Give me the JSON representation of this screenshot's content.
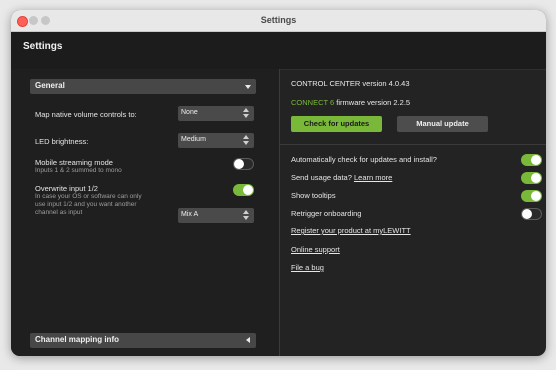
{
  "window": {
    "title": "Settings"
  },
  "app": {
    "title": "Settings"
  },
  "left": {
    "general_header": "General",
    "map_volume_label": "Map native volume controls to:",
    "map_volume_value": "None",
    "led_label": "LED brightness:",
    "led_value": "Medium",
    "mobile_label": "Mobile streaming mode",
    "mobile_sub": "Inputs 1 & 2 summed to mono",
    "mobile_on": false,
    "overwrite_label": "Overwrite input 1/2",
    "overwrite_sub_1": "In case your OS or software can only",
    "overwrite_sub_2": "use input 1/2 and you want another",
    "overwrite_sub_3": "channel as input",
    "overwrite_on": true,
    "mix_value": "Mix A",
    "channel_header": "Channel mapping info"
  },
  "right": {
    "cc_version": "CONTROL CENTER version 4.0.43",
    "fw_brand": "CONNECT 6",
    "fw_version": "firmware version 2.2.5",
    "check_btn": "Check for updates",
    "manual_btn": "Manual update",
    "auto_update_label": "Automatically check for updates and install?",
    "auto_update_on": true,
    "usage_label": "Send usage data?",
    "learn_more": "Learn more",
    "usage_on": true,
    "tooltips_label": "Show tooltips",
    "tooltips_on": true,
    "onboarding_label": "Retrigger onboarding",
    "onboarding_on": false,
    "register_link": "Register your product at myLEWITT",
    "support_link": "Online support",
    "bug_link": "File a bug"
  },
  "colors": {
    "accent": "#7ab83a",
    "background": "#232323",
    "close": "#fe5f57"
  }
}
